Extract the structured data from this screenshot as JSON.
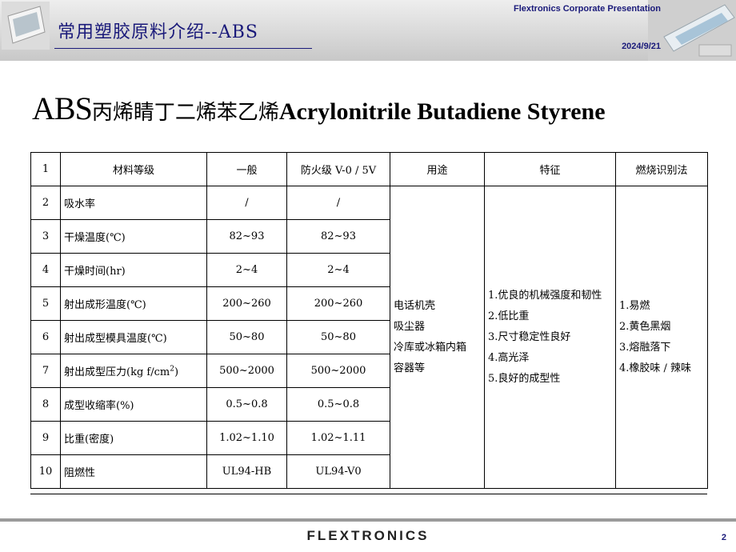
{
  "header": {
    "title": "常用塑胶原料介绍--ABS",
    "corporate": "Flextronics Corporate Presentation",
    "date": "2024/9/21"
  },
  "heading": {
    "abs": "ABS",
    "cn": "丙烯睛丁二烯苯乙烯",
    "en": "Acrylonitrile Butadiene Styrene"
  },
  "table": {
    "header": {
      "num": "1",
      "grade": "材料等级",
      "general": "一般",
      "flame": "防火级 V-0 / 5V",
      "usage": "用途",
      "features": "特征",
      "burn": "燃烧识别法"
    },
    "rows": [
      {
        "num": "2",
        "label": "吸水率",
        "general": "/",
        "flame": "/"
      },
      {
        "num": "3",
        "label": "干燥温度(℃)",
        "general": "82~93",
        "flame": "82~93"
      },
      {
        "num": "4",
        "label": "干燥时间(hr)",
        "general": "2~4",
        "flame": "2~4"
      },
      {
        "num": "5",
        "label": "射出成形温度(℃)",
        "general": "200~260",
        "flame": "200~260"
      },
      {
        "num": "6",
        "label": "射出成型模具温度(℃)",
        "general": "50~80",
        "flame": "50~80"
      },
      {
        "num": "7",
        "label": "射出成型压力(kg f/cm",
        "label_sup": "2",
        "label_end": ")",
        "general": "500~2000",
        "flame": "500~2000"
      },
      {
        "num": "8",
        "label": "成型收缩率(%)",
        "general": "0.5~0.8",
        "flame": "0.5~0.8"
      },
      {
        "num": "9",
        "label": "比重(密度)",
        "general": "1.02~1.10",
        "flame": "1.02~1.11"
      },
      {
        "num": "10",
        "label": "阻燃性",
        "general": "UL94-HB",
        "flame": "UL94-V0"
      }
    ],
    "usage": [
      "电话机壳",
      "吸尘器",
      "冷库或冰箱内箱",
      "容器等"
    ],
    "features": [
      "1.优良的机械强度和韧性",
      "2.低比重",
      "3.尺寸稳定性良好",
      "4.高光泽",
      "5.良好的成型性"
    ],
    "burn": [
      "1.易燃",
      "2.黄色黑烟",
      "3.熔融落下",
      "4.橡胶味 / 辣味"
    ]
  },
  "footer": {
    "logo": "FLEXTRONICS",
    "page": "2"
  },
  "colors": {
    "title_blue": "#1a1a7a",
    "header_gray": "#c8c8c8"
  }
}
